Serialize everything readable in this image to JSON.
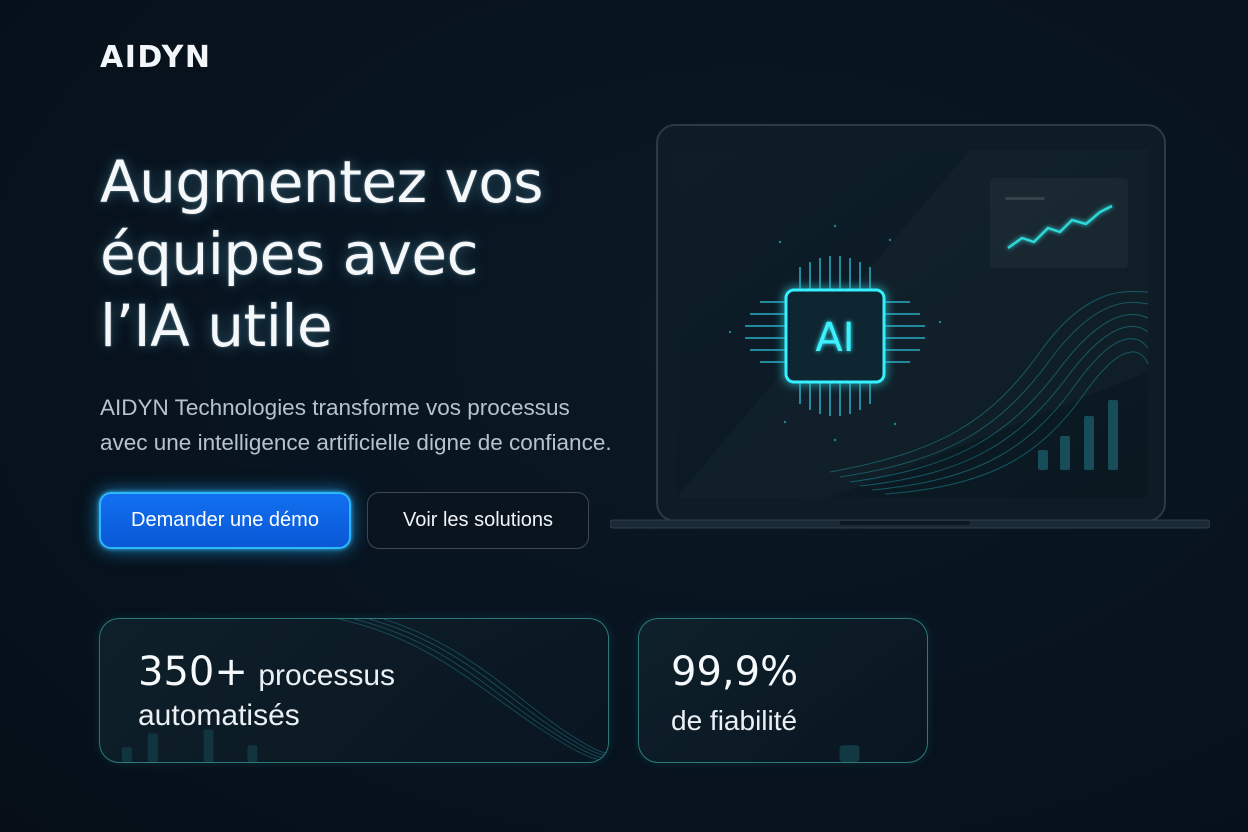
{
  "brand": {
    "logo": "AIDYN"
  },
  "hero": {
    "headline_lines": [
      "Augmentez vos",
      "équipes avec",
      "l’IA utile"
    ],
    "subtitle_lines": [
      "AIDYN Technologies transforme vos processus",
      "avec une intelligence artificielle digne de confiance."
    ]
  },
  "buttons": {
    "primary": "Demander une démo",
    "secondary": "Voir les solutions"
  },
  "stats": [
    {
      "value": "350+",
      "label_line1": "processus",
      "label_line2": "automatisés"
    },
    {
      "value": "99,9%",
      "label_line2": "de fiabilité"
    }
  ],
  "illustration": {
    "chip_label": "AI",
    "icons": [
      "laptop-icon",
      "ai-chip-icon",
      "trend-chart-icon",
      "bar-chart-icon"
    ]
  },
  "colors": {
    "background": "#081420",
    "primary_button": "#0a62e6",
    "accent_cyan": "#2ee6ff",
    "card_border": "#46c8be"
  }
}
